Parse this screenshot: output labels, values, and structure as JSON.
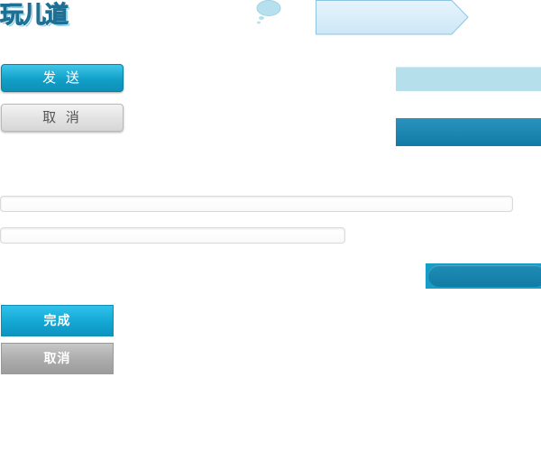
{
  "logo": {
    "text": "玩儿道"
  },
  "actions": {
    "send_label": "发 送",
    "cancel_label": "取 消"
  },
  "form": {
    "field_1_value": "",
    "field_2_value": ""
  },
  "flat_actions": {
    "done_label": "完成",
    "cancel_label": "取消"
  },
  "colors": {
    "accent": "#11a0c8",
    "banner_fill": "#d6ecf9",
    "bar_light": "#b5dfea",
    "bar_dark": "#117aa6"
  }
}
